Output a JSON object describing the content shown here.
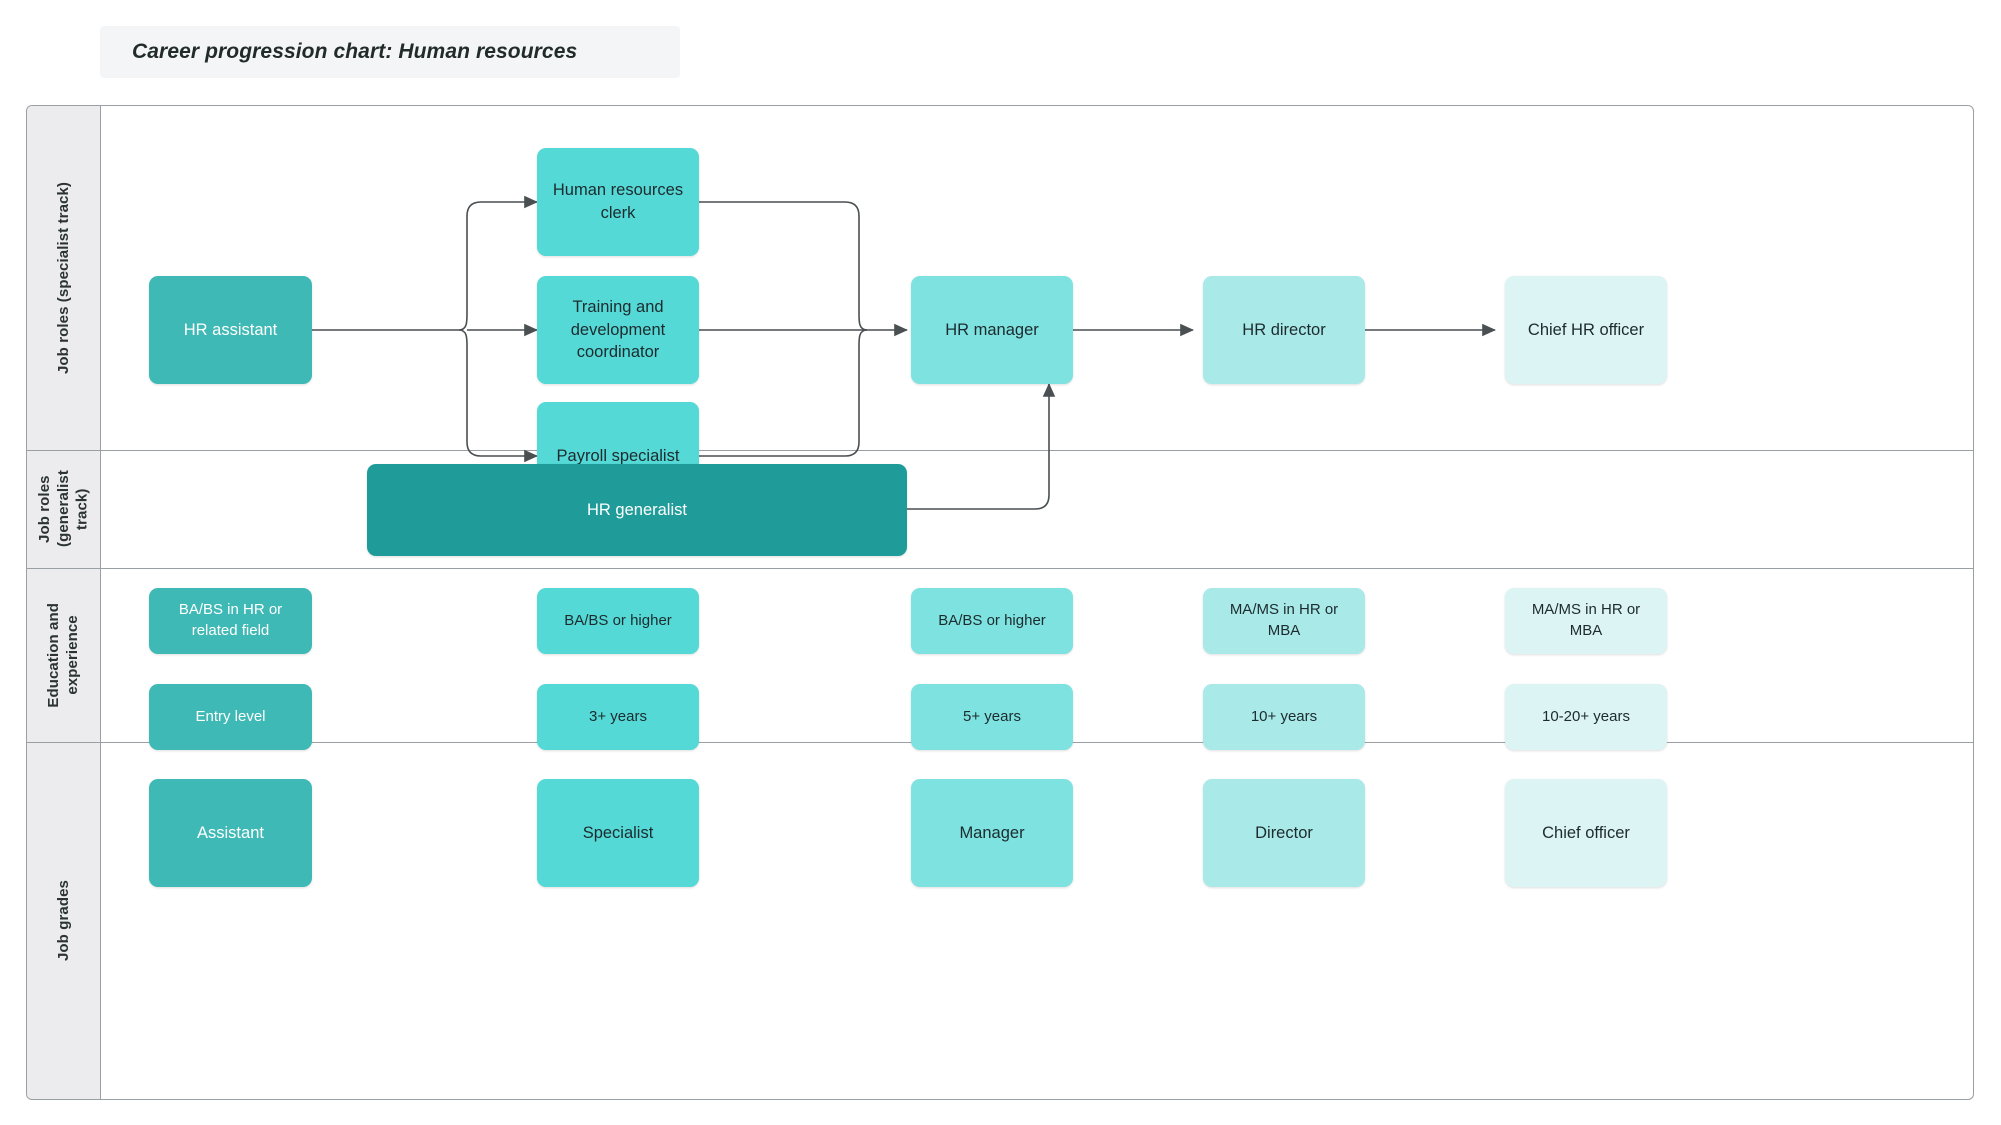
{
  "title": "Career progression chart: Human resources",
  "colors": {
    "tier0_darkest": "#1f9c9a",
    "tier1": "#3fb9b5",
    "tier2": "#54d9d6",
    "tier3": "#7de2e0",
    "tier4": "#a9e9e8",
    "tier5": "#dcf4f3",
    "text_light": "#ffffff",
    "text_dark": "#1d2b2e",
    "connector": "#4a4f52",
    "frame_border": "#999fa3",
    "gutter_bg": "#ececee",
    "title_bg": "#f4f5f7"
  },
  "rows": [
    {
      "id": "specialist",
      "label": "Job roles (specialist track)"
    },
    {
      "id": "generalist",
      "label": "Job roles\n(generalist track)"
    },
    {
      "id": "education",
      "label": "Education and\nexperience"
    },
    {
      "id": "grades",
      "label": "Job grades"
    }
  ],
  "specialist_track": {
    "entry": {
      "label": "HR assistant",
      "tier": "tier1",
      "text": "light"
    },
    "branches": [
      {
        "label": "Human resources clerk",
        "tier": "tier2",
        "text": "dark"
      },
      {
        "label": "Training and development coordinator",
        "tier": "tier2",
        "text": "dark"
      },
      {
        "label": "Payroll specialist",
        "tier": "tier2",
        "text": "dark"
      }
    ],
    "manager": {
      "label": "HR manager",
      "tier": "tier3",
      "text": "dark"
    },
    "director": {
      "label": "HR director",
      "tier": "tier4",
      "text": "dark"
    },
    "chief": {
      "label": "Chief HR officer",
      "tier": "tier5",
      "text": "dark"
    }
  },
  "generalist_track": {
    "node": {
      "label": "HR generalist",
      "tier": "tier0_darkest",
      "text": "light"
    }
  },
  "education": {
    "columns": [
      {
        "degree": "BA/BS in HR or related field",
        "years": "Entry level",
        "tier": "tier1",
        "text": "light"
      },
      {
        "degree": "BA/BS or higher",
        "years": "3+ years",
        "tier": "tier2",
        "text": "dark"
      },
      {
        "degree": "BA/BS or higher",
        "years": "5+ years",
        "tier": "tier3",
        "text": "dark"
      },
      {
        "degree": "MA/MS in HR or MBA",
        "years": "10+ years",
        "tier": "tier4",
        "text": "dark"
      },
      {
        "degree": "MA/MS in HR or MBA",
        "years": "10-20+ years",
        "tier": "tier5",
        "text": "dark"
      }
    ]
  },
  "grades": {
    "items": [
      {
        "label": "Assistant",
        "tier": "tier1",
        "text": "light"
      },
      {
        "label": "Specialist",
        "tier": "tier2",
        "text": "dark"
      },
      {
        "label": "Manager",
        "tier": "tier3",
        "text": "dark"
      },
      {
        "label": "Director",
        "tier": "tier4",
        "text": "dark"
      },
      {
        "label": "Chief officer",
        "tier": "tier5",
        "text": "dark"
      }
    ]
  },
  "chart_data": {
    "type": "diagram",
    "title": "Career progression chart: Human resources",
    "nodes": [
      "HR assistant",
      "Human resources clerk",
      "Training and development coordinator",
      "Payroll specialist",
      "HR manager",
      "HR director",
      "Chief HR officer",
      "HR generalist"
    ],
    "edges": [
      [
        "HR assistant",
        "Human resources clerk"
      ],
      [
        "HR assistant",
        "Training and development coordinator"
      ],
      [
        "HR assistant",
        "Payroll specialist"
      ],
      [
        "Human resources clerk",
        "HR manager"
      ],
      [
        "Training and development coordinator",
        "HR manager"
      ],
      [
        "Payroll specialist",
        "HR manager"
      ],
      [
        "HR manager",
        "HR director"
      ],
      [
        "HR director",
        "Chief HR officer"
      ],
      [
        "HR generalist",
        "HR manager"
      ]
    ]
  }
}
